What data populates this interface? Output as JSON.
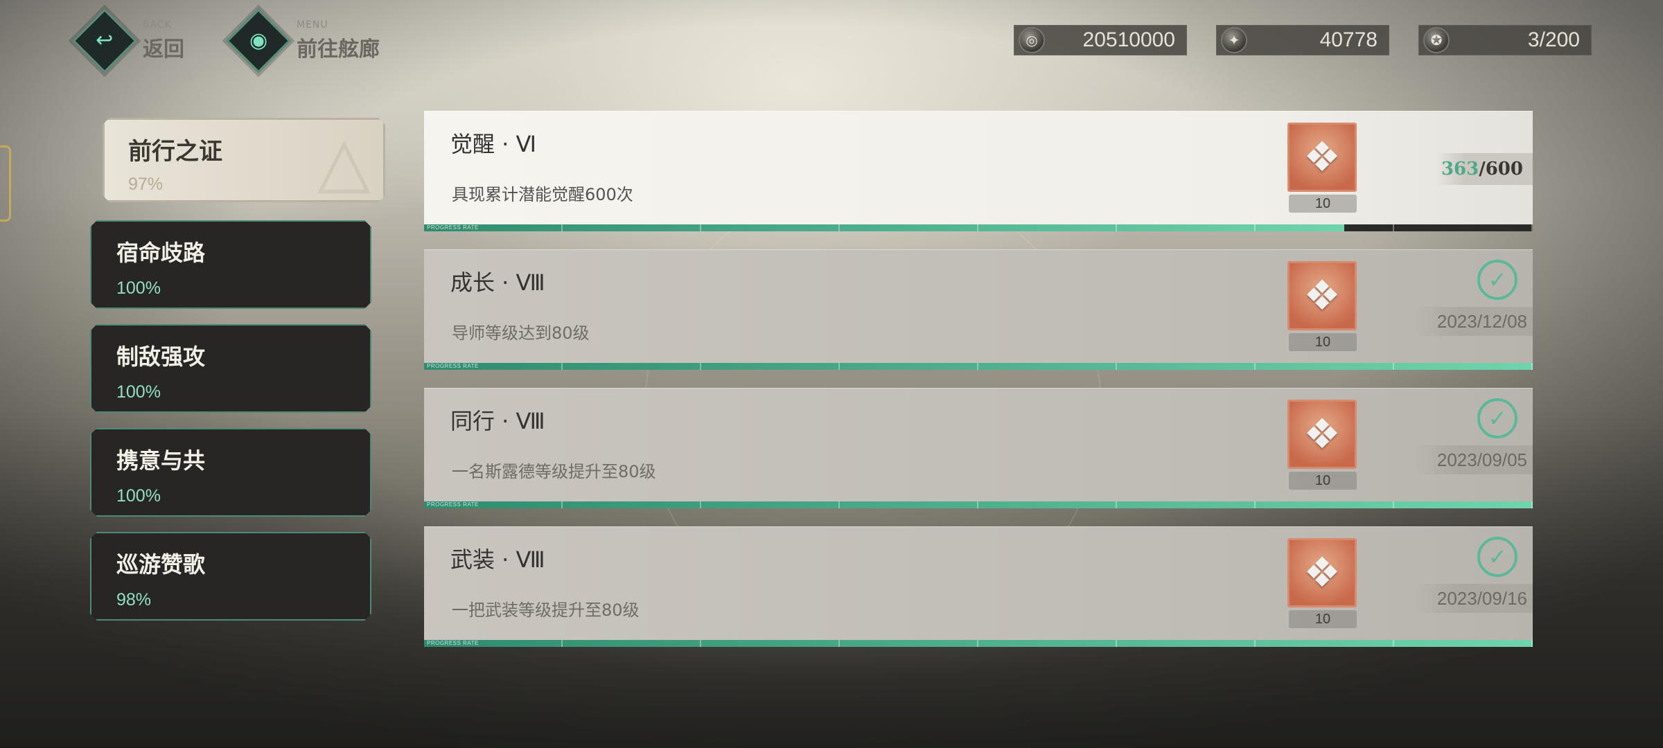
{
  "nav": {
    "back": {
      "en": "BACK",
      "cn": "返回"
    },
    "menu": {
      "en": "MENU",
      "cn": "前往舷廊"
    }
  },
  "currencies": [
    {
      "icon": "coin-icon",
      "value": "20510000"
    },
    {
      "icon": "crystal-icon",
      "value": "40778"
    },
    {
      "icon": "badge-icon",
      "value": "3/200"
    }
  ],
  "categories": [
    {
      "title": "前行之证",
      "percent": "97%",
      "active": true
    },
    {
      "title": "宿命歧路",
      "percent": "100%"
    },
    {
      "title": "制敌强攻",
      "percent": "100%"
    },
    {
      "title": "携意与共",
      "percent": "100%"
    },
    {
      "title": "巡游赞歌",
      "percent": "98%"
    }
  ],
  "achievements": [
    {
      "title": "觉醒 · Ⅵ",
      "description": "具现累计潜能觉醒600次",
      "reward_icon": "crystal-reward-icon",
      "reward_count": "10",
      "status": "in-progress",
      "progress_current": "363",
      "progress_separator": "/",
      "progress_target": "600",
      "progress_fraction": 0.83
    },
    {
      "title": "成长 · Ⅷ",
      "description": "导师等级达到80级",
      "reward_icon": "crystal-reward-icon",
      "reward_count": "10",
      "status": "completed",
      "completed_date": "2023/12/08",
      "progress_fraction": 1.0
    },
    {
      "title": "同行 · Ⅷ",
      "description": "一名斯露德等级提升至80级",
      "reward_icon": "crystal-reward-icon",
      "reward_count": "10",
      "status": "completed",
      "completed_date": "2023/09/05",
      "progress_fraction": 1.0
    },
    {
      "title": "武装 · Ⅷ",
      "description": "一把武装等级提升至80级",
      "reward_icon": "crystal-reward-icon",
      "reward_count": "10",
      "status": "completed",
      "completed_date": "2023/09/16",
      "progress_fraction": 1.0
    }
  ],
  "progress_bar_label": "PROGRESS RATE",
  "colors": {
    "accent": "#5bb99a",
    "progress_current": "#4fa98a",
    "panel_dark": "#282624",
    "panel_border": "#4d8b78"
  }
}
